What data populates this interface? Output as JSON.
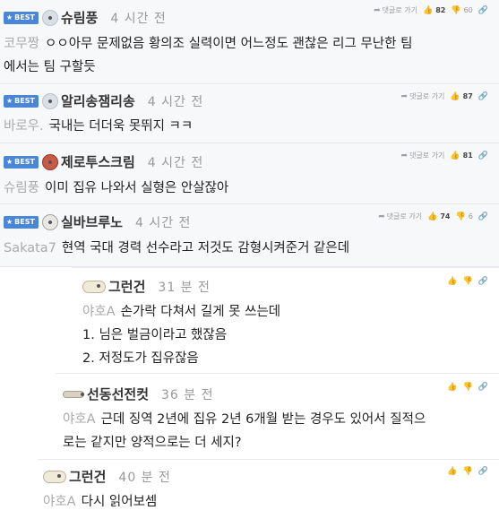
{
  "comments": [
    {
      "best_label": "BEST",
      "nickname": "슈림풍",
      "time": "4 시간 전",
      "reply_label": "댓글로 가기",
      "likes": "82",
      "dislikes": "60",
      "mention": "코무짱",
      "text_1": "ㅇㅇ아무 문제없음 황의조 실력이면 어느정도 괜찮은 리그 무난한 팀",
      "text_2": "에서는 팀 구할듯"
    },
    {
      "best_label": "BEST",
      "nickname": "알리송잼리송",
      "time": "4 시간 전",
      "reply_label": "댓글로 가기",
      "likes": "87",
      "mention": "바로우.",
      "text_1": "국내는 더더욱 못뛰지 ㅋㅋ"
    },
    {
      "best_label": "BEST",
      "nickname": "제로투스크림",
      "time": "4 시간 전",
      "reply_label": "댓글로 가기",
      "likes": "81",
      "mention": "슈림풍",
      "text_1": "이미 집유 나와서 실형은 안살잖아"
    },
    {
      "best_label": "BEST",
      "nickname": "실바브루노",
      "time": "4 시간 전",
      "reply_label": "댓글로 가기",
      "likes": "74",
      "dislikes": "6",
      "mention": "Sakata7",
      "text_1": "현역 국대 경력 선수라고 저것도 감형시켜준거 같은데"
    }
  ],
  "replies": [
    {
      "nickname": "그런건",
      "time": "31 분 전",
      "mention": "야호A",
      "text_1": "손가락 다쳐서 길게 못 쓰는데",
      "text_2": "1. 님은 벌금이라고 했잖음",
      "text_3": "2. 저정도가 집유잖음"
    },
    {
      "nickname": "선동선전컷",
      "time": "36 분 전",
      "mention": "야호A",
      "text_1": "근데 징역 2년에 집유 2년 6개월 받는 경우도 있어서 질적으",
      "text_2": "로는 같지만 양적으로는 더 세지?"
    },
    {
      "nickname": "그런건",
      "time": "40 분 전",
      "mention": "야호A",
      "text_1": "다시 읽어보셈"
    }
  ]
}
